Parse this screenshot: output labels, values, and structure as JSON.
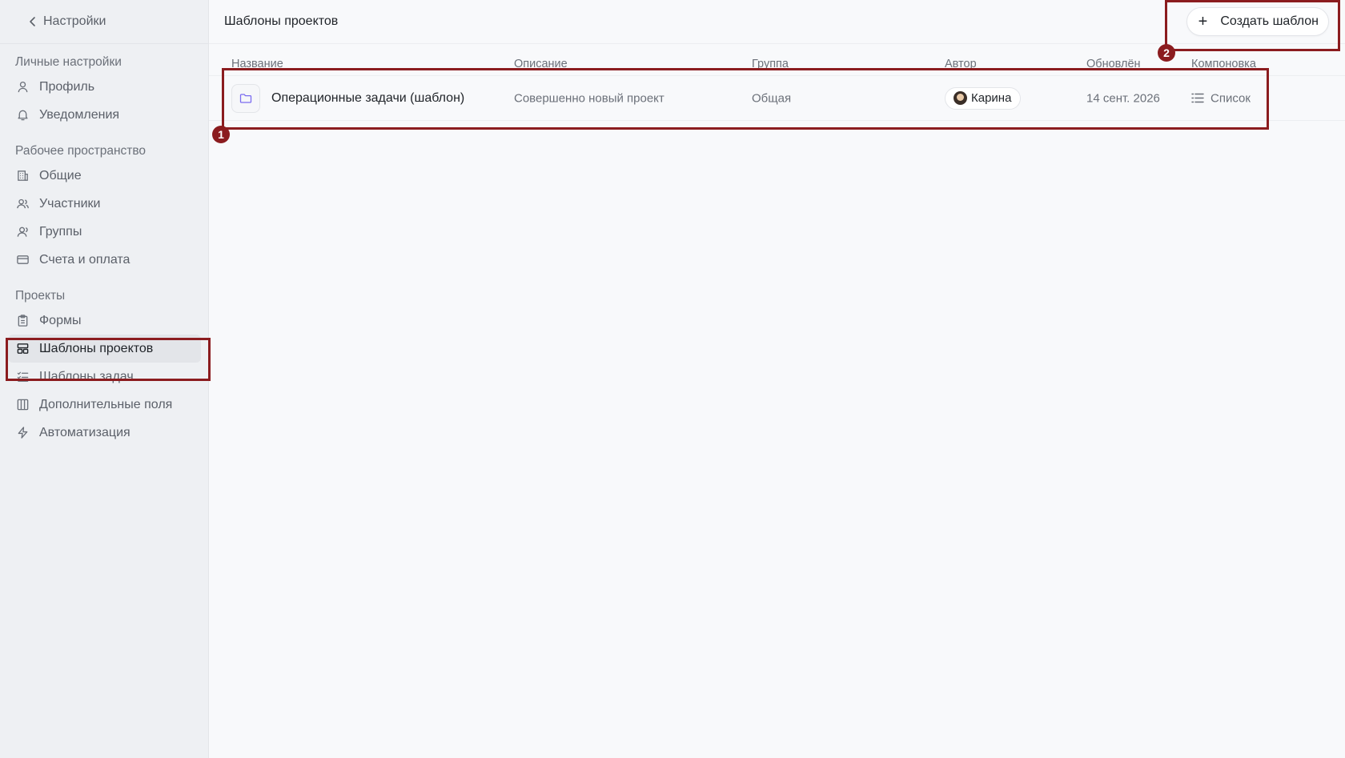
{
  "sidebar": {
    "back_label": "Настройки",
    "sections": [
      {
        "title": "Личные настройки",
        "items": [
          {
            "label": "Профиль",
            "icon": "user-icon"
          },
          {
            "label": "Уведомления",
            "icon": "bell-icon"
          }
        ]
      },
      {
        "title": "Рабочее пространство",
        "items": [
          {
            "label": "Общие",
            "icon": "building-icon"
          },
          {
            "label": "Участники",
            "icon": "users-icon"
          },
          {
            "label": "Группы",
            "icon": "group-icon"
          },
          {
            "label": "Счета и оплата",
            "icon": "card-icon"
          }
        ]
      },
      {
        "title": "Проекты",
        "items": [
          {
            "label": "Формы",
            "icon": "clipboard-icon"
          },
          {
            "label": "Шаблоны проектов",
            "icon": "layout-icon",
            "active": true
          },
          {
            "label": "Шаблоны задач",
            "icon": "checklist-icon"
          },
          {
            "label": "Дополнительные поля",
            "icon": "columns-icon"
          },
          {
            "label": "Автоматизация",
            "icon": "lightning-icon"
          }
        ]
      }
    ]
  },
  "header": {
    "title": "Шаблоны проектов",
    "create_button": "Создать шаблон"
  },
  "table": {
    "columns": [
      "Название",
      "Описание",
      "Группа",
      "Автор",
      "Обновлён",
      "Компоновка"
    ],
    "rows": [
      {
        "name": "Операционные задачи (шаблон)",
        "description": "Совершенно новый проект",
        "group": "Общая",
        "author": "Карина",
        "updated": "14 сент. 2026",
        "layout": "Список"
      }
    ]
  },
  "annotations": [
    "1",
    "2"
  ],
  "colors": {
    "annotation": "#8b1c1f",
    "folder_icon": "#7b6cf0",
    "sidebar_bg": "#eef0f3",
    "main_bg": "#f8f9fb"
  }
}
